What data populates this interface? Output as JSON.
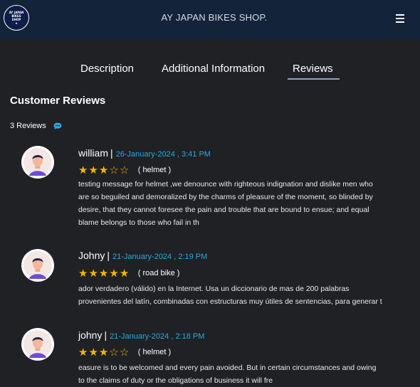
{
  "header": {
    "logo_text": [
      "AY JAPAN",
      "BIKES",
      "SHOP",
      "★"
    ],
    "brand": "AY JAPAN BIKES SHOP.",
    "menu_icon": "hamburger-menu-icon"
  },
  "tabs": [
    {
      "label": "Description",
      "active": false
    },
    {
      "label": "Additional Information",
      "active": false
    },
    {
      "label": "Reviews",
      "active": true
    }
  ],
  "reviews_section": {
    "title": "Customer Reviews",
    "count_label": "3 Reviews",
    "count_icon": "chat-bubble-icon"
  },
  "reviews": [
    {
      "name": "william",
      "separator": "|",
      "date": "26-January-2024 , 3:41 PM",
      "rating": 3,
      "max_rating": 5,
      "category": "( helmet )",
      "text": "testing message for helmet ,we denounce with righteous indignation and dislike men who\nare so beguiled and demoralized by the charms of pleasure of the moment, so blinded by\ndesire, that they cannot foresee the pain and trouble that are bound to ensue; and equal\nblame belongs to those who fail in th"
    },
    {
      "name": "Johny",
      "separator": "|",
      "date": "21-January-2024 , 2:19 PM",
      "rating": 5,
      "max_rating": 5,
      "category": "( road bike )",
      "text": "ador verdadero (válido) en la Internet. Usa un diccionario de mas de 200 palabras\nprovenientes del latín, combinadas con estructuras muy útiles de sentencias, para generar t"
    },
    {
      "name": "johny",
      "separator": "|",
      "date": "21-January-2024 , 2:18 PM",
      "rating": 3,
      "max_rating": 5,
      "category": "( helmet )",
      "text": "easure is to be welcomed and every pain avoided. But in certain circumstances and owing\nto the claims of duty or the obligations of business it will fre"
    }
  ],
  "colors": {
    "background": "#1f2125",
    "header": "#13233a",
    "accent_date": "#29a9e1",
    "star": "#f5b400",
    "tab_underline": "#8ea0c8"
  }
}
